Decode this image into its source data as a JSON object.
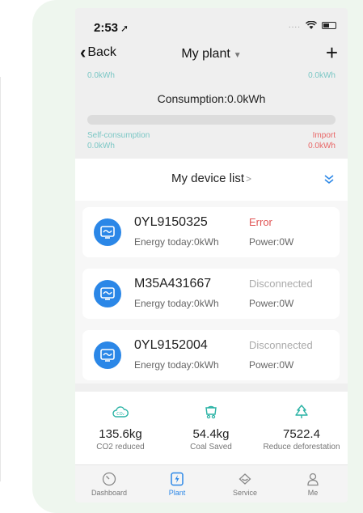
{
  "status_bar": {
    "time": "2:53"
  },
  "nav": {
    "back_label": "Back",
    "title": "My plant",
    "add_label": "+"
  },
  "energy": {
    "top_left_value": "0.0kWh",
    "top_right_value": "0.0kWh",
    "consumption": "Consumption:0.0kWh",
    "self_consumption_label": "Self-consumption",
    "self_consumption_value": "0.0kWh",
    "import_label": "Import",
    "import_value": "0.0kWh"
  },
  "device_list": {
    "title": "My device list",
    "devices": [
      {
        "serial": "0YL9150325",
        "status": "Error",
        "energy": "Energy today:0kWh",
        "power": "Power:0W"
      },
      {
        "serial": "M35A431667",
        "status": "Disconnected",
        "energy": "Energy today:0kWh",
        "power": "Power:0W"
      },
      {
        "serial": "0YL9152004",
        "status": "Disconnected",
        "energy": "Energy today:0kWh",
        "power": "Power:0W"
      }
    ]
  },
  "stats": [
    {
      "value": "135.6kg",
      "label": "CO2 reduced",
      "icon": "co2-cloud-icon"
    },
    {
      "value": "54.4kg",
      "label": "Coal Saved",
      "icon": "coal-cart-icon"
    },
    {
      "value": "7522.4",
      "label": "Reduce deforestation",
      "icon": "tree-icon"
    }
  ],
  "tabs": [
    {
      "label": "Dashboard",
      "icon": "dashboard-icon"
    },
    {
      "label": "Plant",
      "icon": "plant-icon",
      "active": true
    },
    {
      "label": "Service",
      "icon": "service-icon"
    },
    {
      "label": "Me",
      "icon": "me-icon"
    }
  ],
  "colors": {
    "accent": "#2b87e7",
    "error": "#e05555",
    "disconnected": "#aaaaaa",
    "self_consumption": "#7bc7c5",
    "import": "#e86666",
    "stats_icon": "#2bb3a5"
  }
}
